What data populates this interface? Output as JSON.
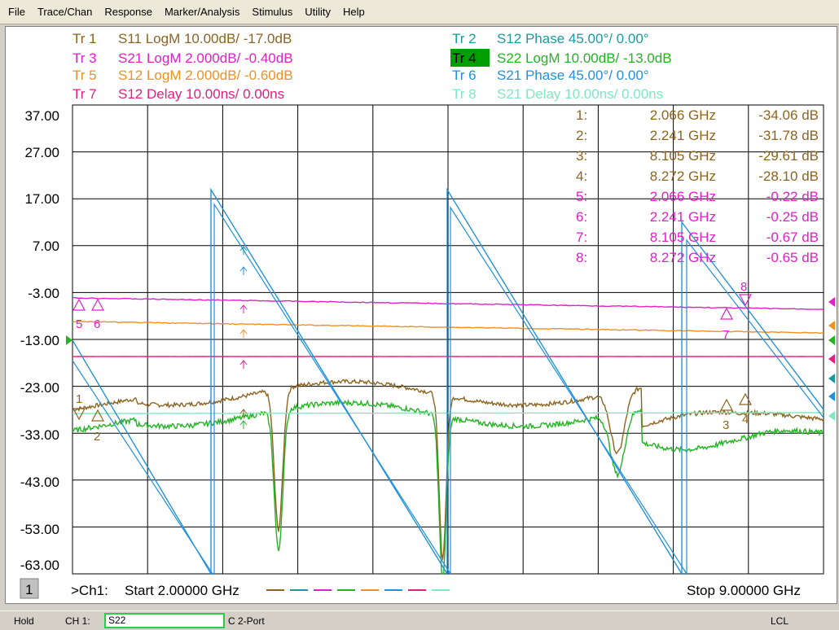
{
  "menu": [
    "File",
    "Trace/Chan",
    "Response",
    "Marker/Analysis",
    "Stimulus",
    "Utility",
    "Help"
  ],
  "traces": [
    {
      "id": "Tr 1",
      "param": "S11 LogM 10.00dB/ -17.0dB",
      "color": "#8c6420",
      "active": false
    },
    {
      "id": "Tr 2",
      "param": "S12 Phase 45.00°/ 0.00°",
      "color": "#1a9aa0",
      "active": false
    },
    {
      "id": "Tr 3",
      "param": "S21 LogM 2.000dB/ -0.40dB",
      "color": "#e020c8",
      "active": false
    },
    {
      "id": "Tr 4",
      "param": "S22 LogM 10.00dB/ -13.0dB",
      "color": "#22b422",
      "active": true
    },
    {
      "id": "Tr 5",
      "param": "S12 LogM 2.000dB/ -0.60dB",
      "color": "#f09020",
      "active": false
    },
    {
      "id": "Tr 6",
      "param": "S21 Phase 45.00°/ 0.00°",
      "color": "#2090e0",
      "active": false
    },
    {
      "id": "Tr 7",
      "param": "S12 Delay 10.00ns/ 0.00ns",
      "color": "#e02080",
      "active": false
    },
    {
      "id": "Tr 8",
      "param": "S21 Delay 10.00ns/ 0.00ns",
      "color": "#80e8c0",
      "active": false
    }
  ],
  "y_axis_labels": [
    "37.00",
    "27.00",
    "17.00",
    "7.00",
    "-3.00",
    "-13.00",
    "-23.00",
    "-33.00",
    "-43.00",
    "-53.00",
    "-63.00"
  ],
  "markers": [
    {
      "num": "1:",
      "freq": "2.066 GHz",
      "value": "-34.06 dB",
      "color": "#8c6420"
    },
    {
      "num": "2:",
      "freq": "2.241 GHz",
      "value": "-31.78 dB",
      "color": "#8c6420"
    },
    {
      "num": "3:",
      "freq": "8.105 GHz",
      "value": "-29.61 dB",
      "color": "#8c6420"
    },
    {
      "num": "4:",
      "freq": "8.272 GHz",
      "value": "-28.10 dB",
      "color": "#8c6420"
    },
    {
      "num": "5:",
      "freq": "2.066 GHz",
      "value": "-0.22 dB",
      "color": "#e020c8"
    },
    {
      "num": "6:",
      "freq": "2.241 GHz",
      "value": "-0.25 dB",
      "color": "#e020c8"
    },
    {
      "num": "7:",
      "freq": "8.105 GHz",
      "value": "-0.67 dB",
      "color": "#e020c8"
    },
    {
      "num": "8:",
      "freq": "8.272 GHz",
      "value": "-0.65 dB",
      "color": "#e020c8"
    }
  ],
  "marker_tags": [
    "5",
    "6",
    "1",
    "2",
    "7",
    "8",
    "3",
    "4"
  ],
  "channel_num": "1",
  "footer": {
    "ch": ">Ch1:",
    "start": "Start  2.00000 GHz",
    "stop": "Stop  9.00000 GHz"
  },
  "status": {
    "hold": "Hold",
    "ch": "CH 1:",
    "meas": "S22",
    "cal": "C  2-Port",
    "lcl": "LCL"
  },
  "colors": {
    "grid": "#000000",
    "s11": "#8c6420",
    "s22": "#22b422",
    "s21_mag": "#e020c8",
    "s12_mag": "#f09020",
    "s12_delay": "#e02080",
    "s21_delay": "#80e8c0",
    "phase12": "#1a9aa0",
    "phase21": "#2090e0"
  }
}
